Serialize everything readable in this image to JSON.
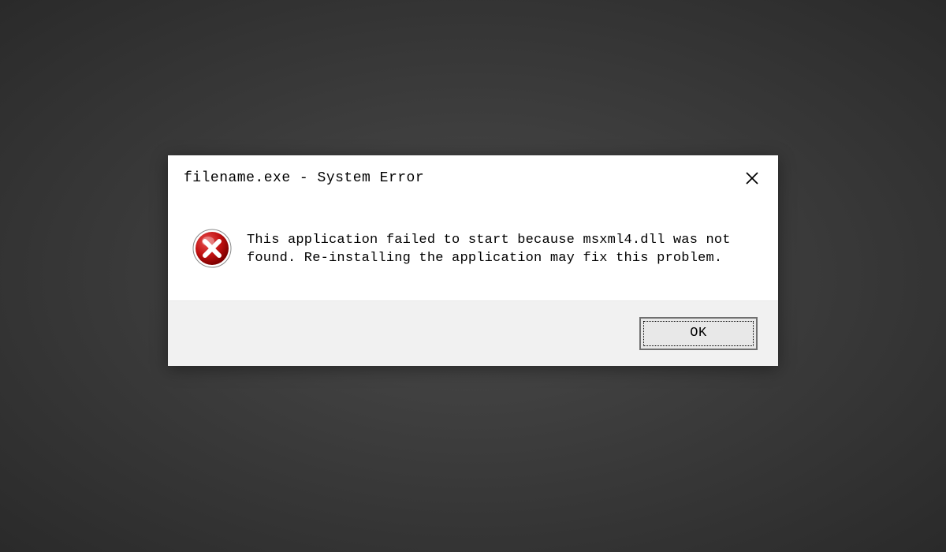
{
  "dialog": {
    "title": "filename.exe - System Error",
    "message": "This application failed to start because msxml4.dll was not found. Re-installing the application may fix this problem.",
    "ok_label": "OK"
  }
}
